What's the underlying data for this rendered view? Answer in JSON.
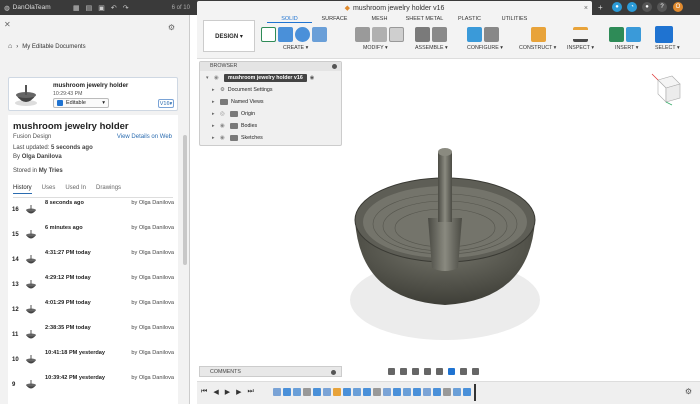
{
  "appbar": {
    "team": "DanOlaTeam",
    "pages": "6 of 10",
    "doc_tab": "mushroom jewelry holder v16",
    "close": "×",
    "plus": "+"
  },
  "left": {
    "breadcrumb": "My Editable Documents",
    "card": {
      "name": "mushroom jewelry holder",
      "time": "10:29:43 PM",
      "status": "Editable",
      "version": "V16"
    },
    "title": "mushroom jewelry holder",
    "product": "Fusion Design",
    "view_link": "View Details on Web",
    "updated_label": "Last updated:",
    "updated_value": "5 seconds ago",
    "by_label": "By",
    "by_value": "Olga Danilova",
    "stored_label": "Stored in",
    "stored_value": "My Tries",
    "tabs": [
      "History",
      "Uses",
      "Used In",
      "Drawings"
    ],
    "history": [
      {
        "num": "16",
        "when": "8 seconds ago",
        "who": "by Olga Danilova"
      },
      {
        "num": "15",
        "when": "6 minutes ago",
        "who": "by Olga Danilova"
      },
      {
        "num": "14",
        "when": "4:31:27 PM today",
        "who": "by Olga Danilova"
      },
      {
        "num": "13",
        "when": "4:29:12 PM today",
        "who": "by Olga Danilova"
      },
      {
        "num": "12",
        "when": "4:01:29 PM today",
        "who": "by Olga Danilova"
      },
      {
        "num": "11",
        "when": "2:38:35 PM today",
        "who": "by Olga Danilova"
      },
      {
        "num": "10",
        "when": "10:41:18 PM yesterday",
        "who": "by Olga Danilova"
      },
      {
        "num": "9",
        "when": "10:39:42 PM yesterday",
        "who": "by Olga Danilova"
      }
    ]
  },
  "toolbar": {
    "design": "DESIGN ▾",
    "workspace_tabs": [
      "SOLID",
      "SURFACE",
      "MESH",
      "SHEET METAL",
      "PLASTIC",
      "UTILITIES"
    ],
    "groups": [
      "CREATE ▾",
      "MODIFY ▾",
      "ASSEMBLE ▾",
      "CONFIGURE ▾",
      "CONSTRUCT ▾",
      "INSPECT ▾",
      "INSERT ▾",
      "SELECT ▾"
    ]
  },
  "browser": {
    "header": "BROWSER",
    "root": "mushroom jewelry holder v16",
    "items": [
      "Document Settings",
      "Named Views",
      "Origin",
      "Bodies",
      "Sketches"
    ]
  },
  "comments": "COMMENTS",
  "colors": {
    "accent": "#1f73d1",
    "appbar": "#3a3a3a",
    "model": "#5a5a52"
  }
}
